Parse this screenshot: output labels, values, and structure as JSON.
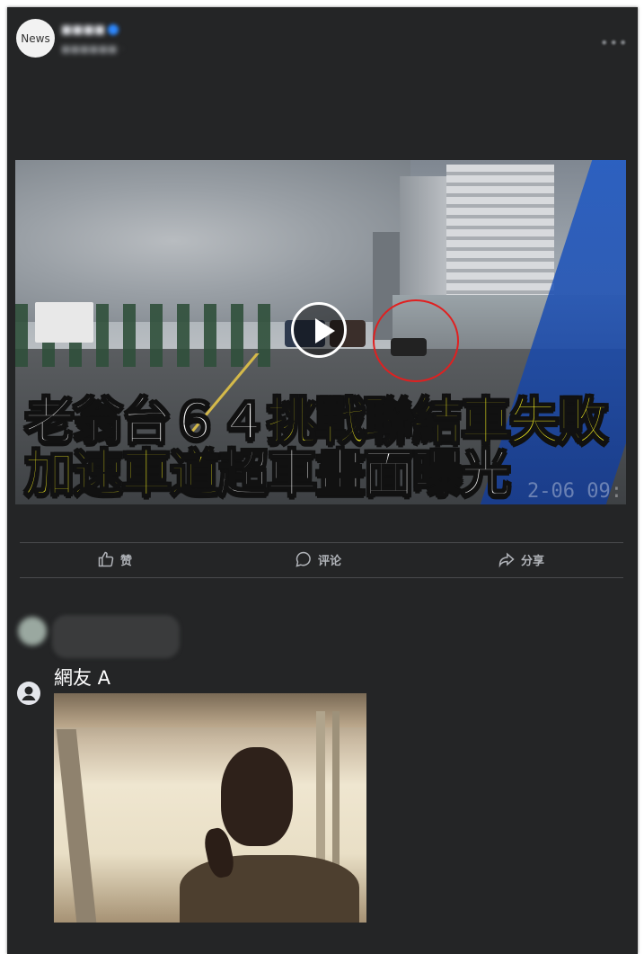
{
  "post": {
    "avatar_text": "News",
    "page_name": "■■■■",
    "time": "■■■■■■ ·",
    "more": "•••",
    "caption_tag": "",
    "caption": "",
    "caption_link": ""
  },
  "video": {
    "headline_line1_white": "老翁台６４",
    "headline_line1_yellow": "挑戰聯結車失敗",
    "headline_line2_yellow": "加速車道",
    "headline_line2_white": "超車畫面曝光",
    "timestamp": "2-06 09:"
  },
  "actions": {
    "like": "赞",
    "comment": "评论",
    "share": "分享"
  },
  "comments": {
    "filter_label": "",
    "first_commenter": "",
    "first_comment_meta": "",
    "reply_user": "網友 A"
  },
  "colors": {
    "post_background": "#242526",
    "headline_yellow": "#f5ef1f",
    "marker_red": "#e02020",
    "link_blue": "#4599ff"
  }
}
